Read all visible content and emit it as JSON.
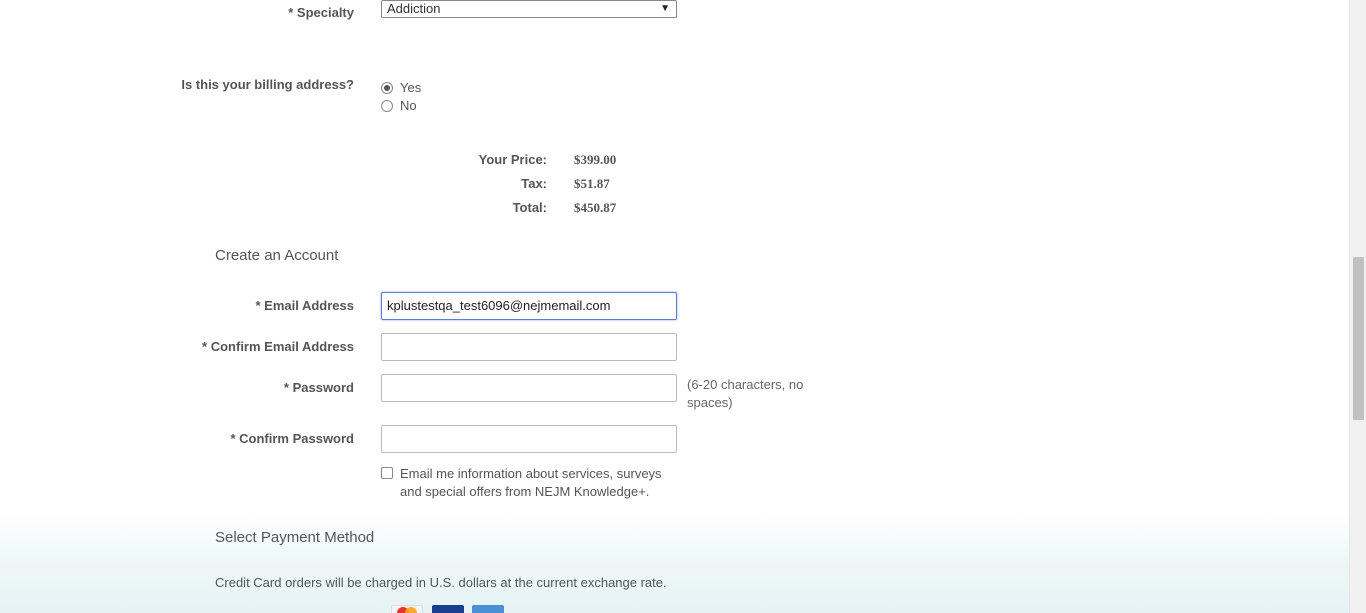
{
  "form": {
    "specialty": {
      "label": "* Specialty",
      "value": "Addiction"
    },
    "billing": {
      "label": "Is this your billing address?",
      "options": [
        {
          "label": "Yes",
          "checked": true
        },
        {
          "label": "No",
          "checked": false
        }
      ]
    }
  },
  "pricing": {
    "your_price_label": "Your Price:",
    "your_price_value": "$399.00",
    "tax_label": "Tax:",
    "tax_value": "$51.87",
    "total_label": "Total:",
    "total_value": "$450.87"
  },
  "account": {
    "title": "Create an Account",
    "email_label": "* Email Address",
    "email_value": "kplustestqa_test6096@nejmemail.com",
    "confirm_email_label": "* Confirm Email Address",
    "confirm_email_value": "",
    "password_label": "* Password",
    "password_hint": "(6-20 characters, no spaces)",
    "confirm_password_label": "* Confirm Password",
    "opt_in_label": "Email me information about services, surveys and special offers from NEJM Knowledge+.",
    "opt_in_checked": false
  },
  "payment": {
    "title": "Select Payment Method",
    "note": "Credit Card orders will be charged in U.S. dollars at the current exchange rate.",
    "cards": [
      "mastercard-icon",
      "visa-icon",
      "amex-icon"
    ]
  }
}
